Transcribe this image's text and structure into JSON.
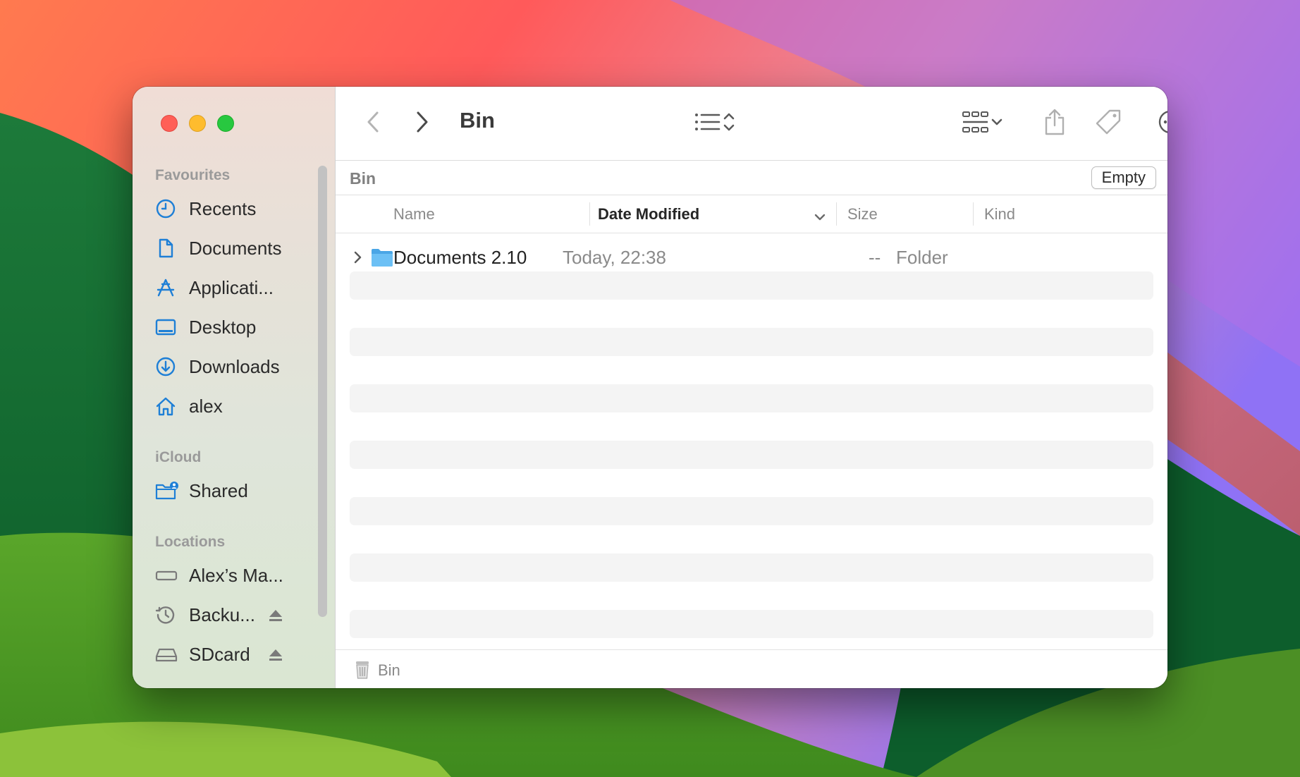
{
  "window": {
    "title": "Bin"
  },
  "sidebar": {
    "sections": [
      {
        "label": "Favourites"
      },
      {
        "label": "iCloud"
      },
      {
        "label": "Locations"
      }
    ],
    "favourites": [
      {
        "label": "Recents",
        "icon": "clock-icon"
      },
      {
        "label": "Documents",
        "icon": "document-icon"
      },
      {
        "label": "Applicati...",
        "icon": "applications-icon"
      },
      {
        "label": "Desktop",
        "icon": "desktop-icon"
      },
      {
        "label": "Downloads",
        "icon": "download-icon"
      },
      {
        "label": "alex",
        "icon": "home-icon"
      }
    ],
    "icloud": [
      {
        "label": "Shared",
        "icon": "shared-folder-icon"
      }
    ],
    "locations": [
      {
        "label": "Alex’s Ma...",
        "icon": "computer-icon"
      },
      {
        "label": "Backu...",
        "icon": "time-machine-icon",
        "eject": true
      },
      {
        "label": "SDcard",
        "icon": "drive-icon",
        "eject": true
      }
    ]
  },
  "toolbar": {
    "back_icon": "chevron-left-icon",
    "forward_icon": "chevron-right-icon",
    "list_view_icon": "list-view-icon",
    "group_icon": "grid-group-icon",
    "share_icon": "share-icon",
    "tag_icon": "tag-icon",
    "more_icon": "ellipsis-circle-icon",
    "search_icon": "search-icon"
  },
  "content": {
    "path_title": "Bin",
    "empty_button": "Empty",
    "columns": {
      "name": "Name",
      "date_modified": "Date Modified",
      "size": "Size",
      "kind": "Kind"
    },
    "rows": [
      {
        "name": "Documents 2.10",
        "date_modified": "Today, 22:38",
        "size": "--",
        "kind": "Folder"
      }
    ]
  },
  "statusbar": {
    "path_label": "Bin",
    "icon": "trash-icon"
  },
  "colors": {
    "accent": "#1e7fd6",
    "folder": "#5ab3ee"
  }
}
